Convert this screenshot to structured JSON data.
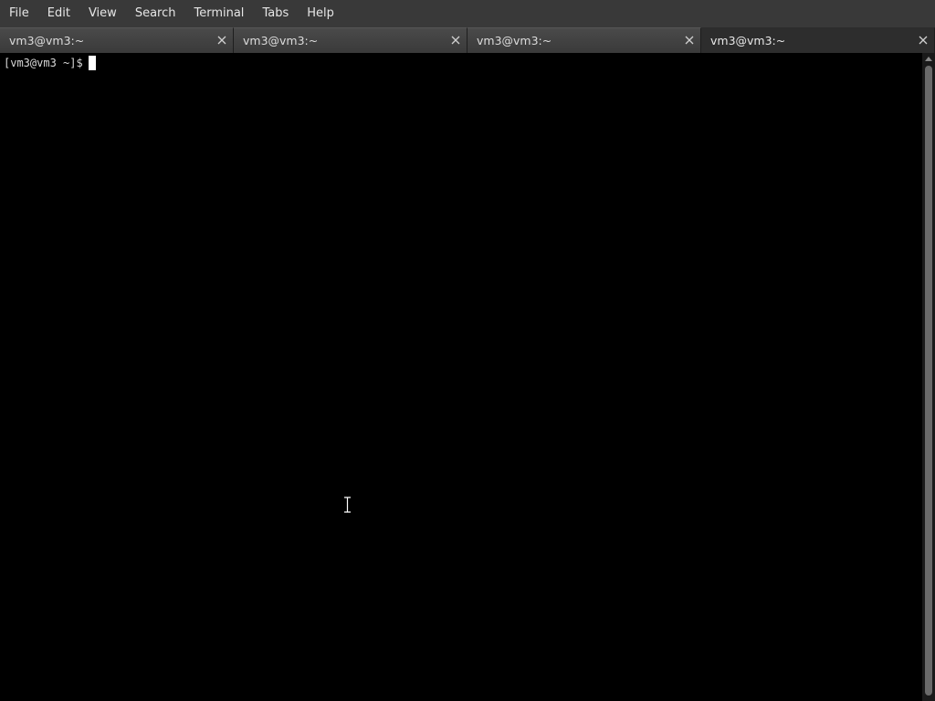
{
  "menubar": {
    "items": [
      {
        "id": "file",
        "label": "File"
      },
      {
        "id": "edit",
        "label": "Edit"
      },
      {
        "id": "view",
        "label": "View"
      },
      {
        "id": "search",
        "label": "Search"
      },
      {
        "id": "terminal",
        "label": "Terminal"
      },
      {
        "id": "tabs",
        "label": "Tabs"
      },
      {
        "id": "help",
        "label": "Help"
      }
    ]
  },
  "tabs": [
    {
      "label": "vm3@vm3:~",
      "active": false,
      "close_icon": "close-icon"
    },
    {
      "label": "vm3@vm3:~",
      "active": false,
      "close_icon": "close-icon"
    },
    {
      "label": "vm3@vm3:~",
      "active": false,
      "close_icon": "close-icon"
    },
    {
      "label": "vm3@vm3:~",
      "active": true,
      "close_icon": "close-icon"
    }
  ],
  "terminal": {
    "prompt": "[vm3@vm3 ~]$"
  },
  "colors": {
    "menubar_bg": "#393939",
    "terminal_bg": "#000000",
    "text": "#d8d8d8"
  }
}
